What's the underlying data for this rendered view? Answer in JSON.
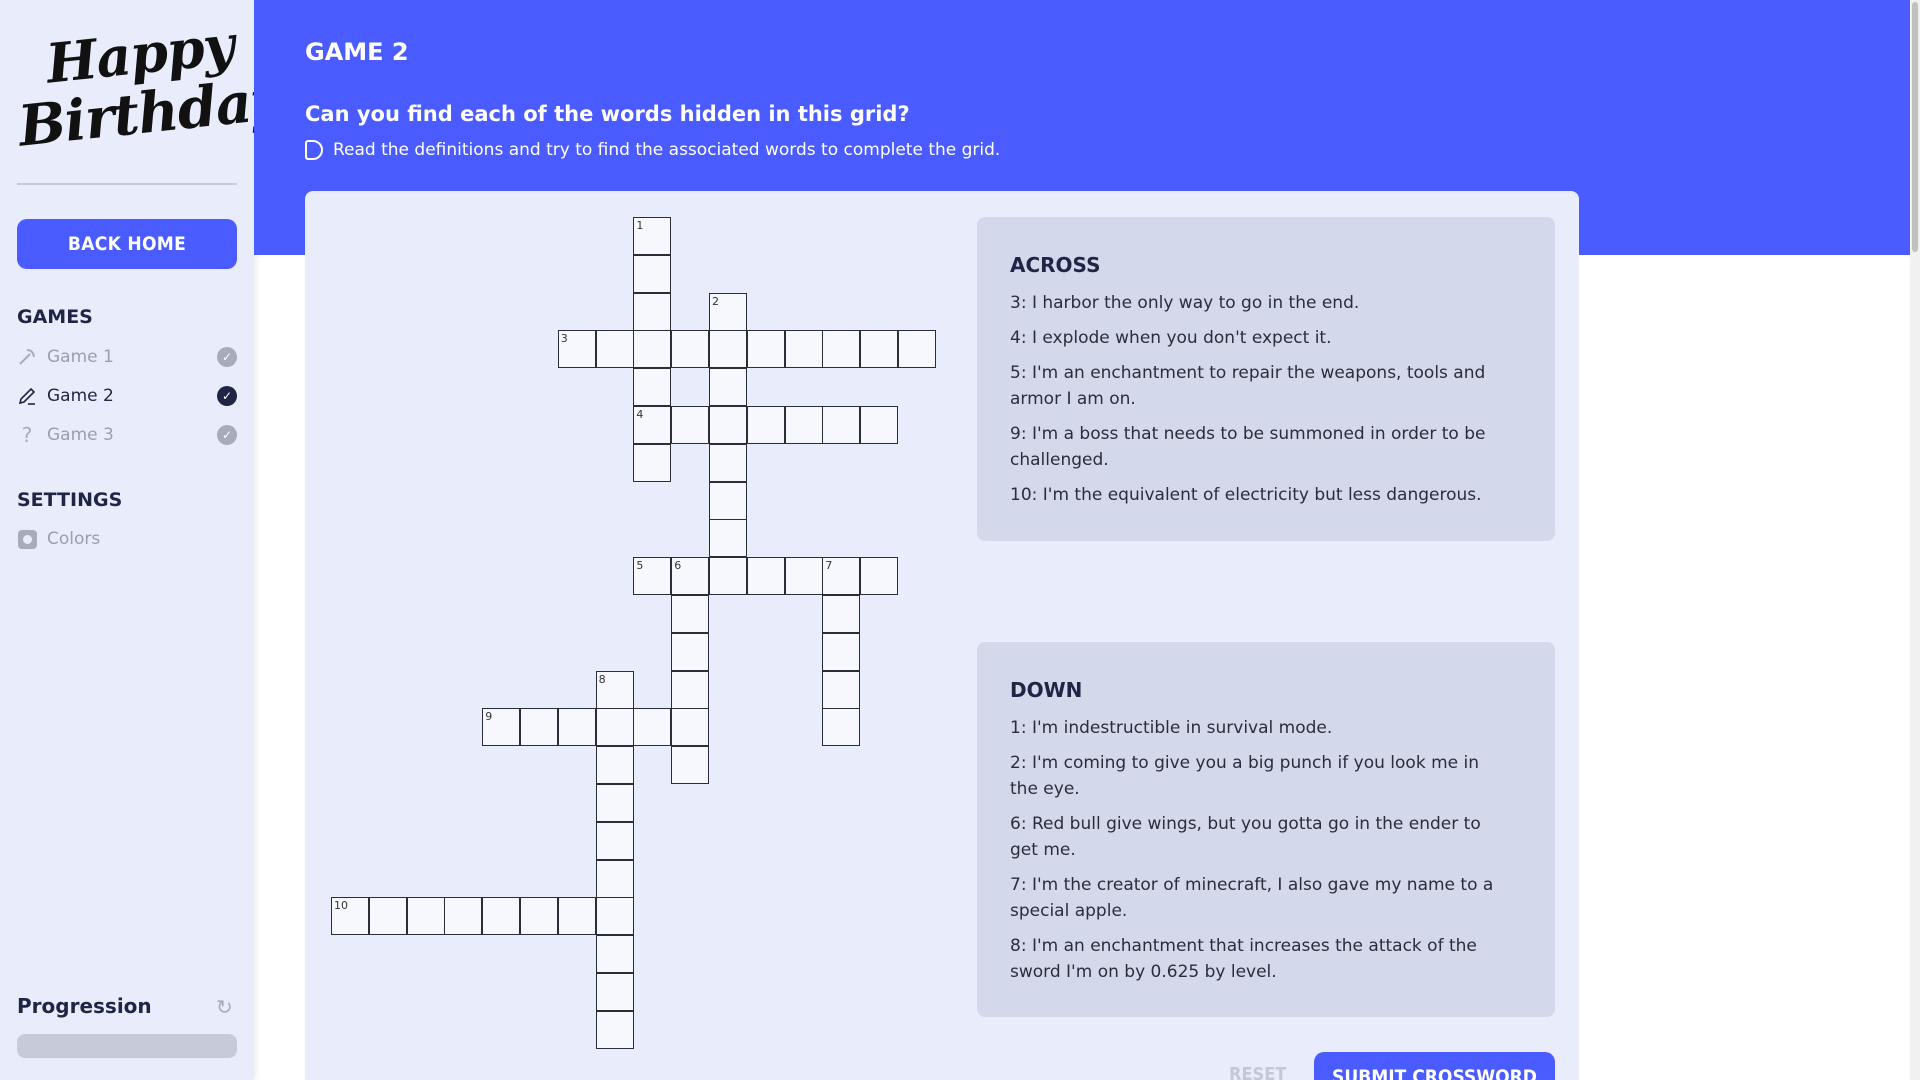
{
  "sidebar": {
    "logo": {
      "line1": "Happy",
      "line2": "Birthday"
    },
    "back_home": "BACK HOME",
    "games_heading": "GAMES",
    "games": [
      {
        "label": "Game 1",
        "icon": "pickaxe-icon",
        "completed": true
      },
      {
        "label": "Game 2",
        "icon": "pencil-icon",
        "completed": true,
        "active": true
      },
      {
        "label": "Game 3",
        "icon": "question-icon",
        "completed": true
      }
    ],
    "settings_heading": "SETTINGS",
    "settings": [
      {
        "label": "Colors",
        "icon": "palette-icon"
      }
    ],
    "progression_label": "Progression",
    "progress_fraction": 0
  },
  "main": {
    "game_title": "GAME 2",
    "question": "Can you find each of the words hidden in this grid?",
    "instruction": "Read the definitions and try to find the associated words to complete the grid.",
    "across": {
      "heading": "ACROSS",
      "clues": [
        "3: I harbor the only way to go in the end.",
        "4: I explode when you don't expect it.",
        "5: I'm an enchantment to repair the weapons, tools and armor I am on.",
        "9: I'm a boss that needs to be summoned in order to be challenged.",
        "10: I'm the equivalent of electricity but less dangerous."
      ]
    },
    "down": {
      "heading": "DOWN",
      "clues": [
        "1: I'm indestructible in survival mode.",
        "2: I'm coming to give you a big punch if you look me in the eye.",
        "6: Red bull give wings, but you gotta go in the ender to get me.",
        "7: I'm the creator of minecraft, I also gave my name to a special apple.",
        "8: I'm an enchantment that increases the attack of the sword I'm on by 0.625 by level."
      ]
    },
    "reset_label": "RESET",
    "submit_label": "SUBMIT CROSSWORD"
  },
  "colors": {
    "accent": "#4a5cff",
    "sidebar_bg": "#e9edfb",
    "card_bg": "#e9edfb",
    "clue_bg": "#d4d8eb"
  }
}
